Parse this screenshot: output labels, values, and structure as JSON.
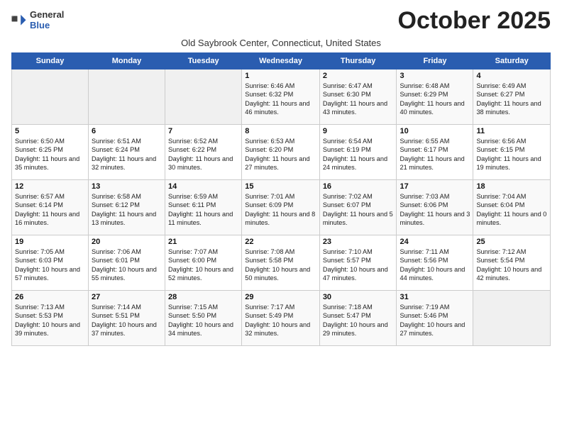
{
  "header": {
    "logo_general": "General",
    "logo_blue": "Blue",
    "month_title": "October 2025",
    "subtitle": "Old Saybrook Center, Connecticut, United States"
  },
  "days_of_week": [
    "Sunday",
    "Monday",
    "Tuesday",
    "Wednesday",
    "Thursday",
    "Friday",
    "Saturday"
  ],
  "weeks": [
    [
      {
        "day": "",
        "empty": true
      },
      {
        "day": "",
        "empty": true
      },
      {
        "day": "",
        "empty": true
      },
      {
        "day": "1",
        "sunrise": "6:46 AM",
        "sunset": "6:32 PM",
        "daylight": "11 hours and 46 minutes."
      },
      {
        "day": "2",
        "sunrise": "6:47 AM",
        "sunset": "6:30 PM",
        "daylight": "11 hours and 43 minutes."
      },
      {
        "day": "3",
        "sunrise": "6:48 AM",
        "sunset": "6:29 PM",
        "daylight": "11 hours and 40 minutes."
      },
      {
        "day": "4",
        "sunrise": "6:49 AM",
        "sunset": "6:27 PM",
        "daylight": "11 hours and 38 minutes."
      }
    ],
    [
      {
        "day": "5",
        "sunrise": "6:50 AM",
        "sunset": "6:25 PM",
        "daylight": "11 hours and 35 minutes."
      },
      {
        "day": "6",
        "sunrise": "6:51 AM",
        "sunset": "6:24 PM",
        "daylight": "11 hours and 32 minutes."
      },
      {
        "day": "7",
        "sunrise": "6:52 AM",
        "sunset": "6:22 PM",
        "daylight": "11 hours and 30 minutes."
      },
      {
        "day": "8",
        "sunrise": "6:53 AM",
        "sunset": "6:20 PM",
        "daylight": "11 hours and 27 minutes."
      },
      {
        "day": "9",
        "sunrise": "6:54 AM",
        "sunset": "6:19 PM",
        "daylight": "11 hours and 24 minutes."
      },
      {
        "day": "10",
        "sunrise": "6:55 AM",
        "sunset": "6:17 PM",
        "daylight": "11 hours and 21 minutes."
      },
      {
        "day": "11",
        "sunrise": "6:56 AM",
        "sunset": "6:15 PM",
        "daylight": "11 hours and 19 minutes."
      }
    ],
    [
      {
        "day": "12",
        "sunrise": "6:57 AM",
        "sunset": "6:14 PM",
        "daylight": "11 hours and 16 minutes."
      },
      {
        "day": "13",
        "sunrise": "6:58 AM",
        "sunset": "6:12 PM",
        "daylight": "11 hours and 13 minutes."
      },
      {
        "day": "14",
        "sunrise": "6:59 AM",
        "sunset": "6:11 PM",
        "daylight": "11 hours and 11 minutes."
      },
      {
        "day": "15",
        "sunrise": "7:01 AM",
        "sunset": "6:09 PM",
        "daylight": "11 hours and 8 minutes."
      },
      {
        "day": "16",
        "sunrise": "7:02 AM",
        "sunset": "6:07 PM",
        "daylight": "11 hours and 5 minutes."
      },
      {
        "day": "17",
        "sunrise": "7:03 AM",
        "sunset": "6:06 PM",
        "daylight": "11 hours and 3 minutes."
      },
      {
        "day": "18",
        "sunrise": "7:04 AM",
        "sunset": "6:04 PM",
        "daylight": "11 hours and 0 minutes."
      }
    ],
    [
      {
        "day": "19",
        "sunrise": "7:05 AM",
        "sunset": "6:03 PM",
        "daylight": "10 hours and 57 minutes."
      },
      {
        "day": "20",
        "sunrise": "7:06 AM",
        "sunset": "6:01 PM",
        "daylight": "10 hours and 55 minutes."
      },
      {
        "day": "21",
        "sunrise": "7:07 AM",
        "sunset": "6:00 PM",
        "daylight": "10 hours and 52 minutes."
      },
      {
        "day": "22",
        "sunrise": "7:08 AM",
        "sunset": "5:58 PM",
        "daylight": "10 hours and 50 minutes."
      },
      {
        "day": "23",
        "sunrise": "7:10 AM",
        "sunset": "5:57 PM",
        "daylight": "10 hours and 47 minutes."
      },
      {
        "day": "24",
        "sunrise": "7:11 AM",
        "sunset": "5:56 PM",
        "daylight": "10 hours and 44 minutes."
      },
      {
        "day": "25",
        "sunrise": "7:12 AM",
        "sunset": "5:54 PM",
        "daylight": "10 hours and 42 minutes."
      }
    ],
    [
      {
        "day": "26",
        "sunrise": "7:13 AM",
        "sunset": "5:53 PM",
        "daylight": "10 hours and 39 minutes."
      },
      {
        "day": "27",
        "sunrise": "7:14 AM",
        "sunset": "5:51 PM",
        "daylight": "10 hours and 37 minutes."
      },
      {
        "day": "28",
        "sunrise": "7:15 AM",
        "sunset": "5:50 PM",
        "daylight": "10 hours and 34 minutes."
      },
      {
        "day": "29",
        "sunrise": "7:17 AM",
        "sunset": "5:49 PM",
        "daylight": "10 hours and 32 minutes."
      },
      {
        "day": "30",
        "sunrise": "7:18 AM",
        "sunset": "5:47 PM",
        "daylight": "10 hours and 29 minutes."
      },
      {
        "day": "31",
        "sunrise": "7:19 AM",
        "sunset": "5:46 PM",
        "daylight": "10 hours and 27 minutes."
      },
      {
        "day": "",
        "empty": true
      }
    ]
  ]
}
